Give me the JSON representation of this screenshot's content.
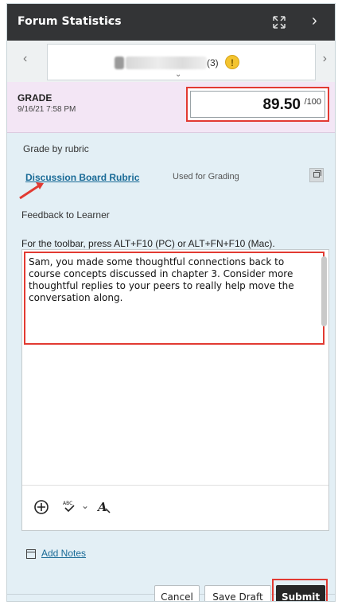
{
  "header": {
    "title": "Forum Statistics",
    "expand_icon": "expand-arrows-icon",
    "next_icon": "chevron-right-icon"
  },
  "student_nav": {
    "prev_icon": "chevron-left-icon",
    "next_icon": "chevron-right-icon",
    "post_count": "(3)"
  },
  "grade": {
    "label": "GRADE",
    "date": "9/16/21 7:58 PM",
    "value": "89.50",
    "max": "/100"
  },
  "rubric": {
    "section_label": "Grade by rubric",
    "link_text": "Discussion Board Rubric",
    "status": "Used for Grading"
  },
  "feedback": {
    "label": "Feedback to Learner",
    "toolbar_hint": "For the toolbar, press ALT+F10 (PC) or ALT+FN+F10 (Mac).",
    "text": "Sam, you made some thoughtful connections back to course concepts discussed in chapter 3. Consider more thoughtful replies to your peers to really help move the conversation along."
  },
  "notes": {
    "link_text": "Add Notes"
  },
  "actions": {
    "cancel": "Cancel",
    "save_draft": "Save Draft",
    "submit": "Submit"
  },
  "colors": {
    "highlight": "#e23a32",
    "link": "#1a6b97",
    "panel": "#e3eff5",
    "grade_panel": "#f3e6f5"
  }
}
